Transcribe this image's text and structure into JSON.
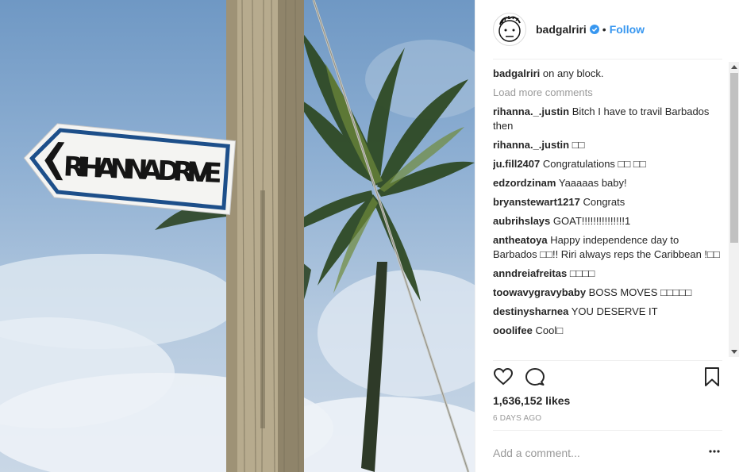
{
  "post": {
    "image_sign_text": "RIHANNA DRIVE",
    "username": "badgalriri",
    "follow_label": "Follow",
    "separator": "•",
    "caption_user": "badgalriri",
    "caption_text": "on any block.",
    "load_more": "Load more comments",
    "comments": [
      {
        "user": "rihanna._.justin",
        "text": "Bitch I have to travil Barbados then"
      },
      {
        "user": "rihanna._.justin",
        "text": "□□"
      },
      {
        "user": "ju.fill2407",
        "text": "Congratulations □□ □□"
      },
      {
        "user": "edzordzinam",
        "text": "Yaaaaas baby!"
      },
      {
        "user": "bryanstewart1217",
        "text": "Congrats"
      },
      {
        "user": "aubrihslays",
        "text": "GOAT!!!!!!!!!!!!!!!1"
      },
      {
        "user": "antheatoya",
        "text": "Happy independence day to Barbados □□!! Riri always reps the Caribbean !□□"
      },
      {
        "user": "anndreiafreitas",
        "text": "□□□□"
      },
      {
        "user": "toowavygravybaby",
        "text": "BOSS MOVES □□□□□"
      },
      {
        "user": "destinysharnea",
        "text": "YOU DESERVE IT"
      },
      {
        "user": "ooolifee",
        "text": "Cool□"
      }
    ],
    "likes": "1,636,152 likes",
    "time_ago": "6 DAYS AGO",
    "add_comment_placeholder": "Add a comment...",
    "icons": {
      "avatar": "avatar-drawing",
      "verified": "verified-badge-icon",
      "like": "heart-icon",
      "comment": "comment-bubble-icon",
      "save": "bookmark-icon",
      "more": "ellipsis-icon"
    },
    "colors": {
      "follow": "#3897f0",
      "verified": "#3897f0",
      "muted": "#999999",
      "text": "#262626"
    }
  }
}
